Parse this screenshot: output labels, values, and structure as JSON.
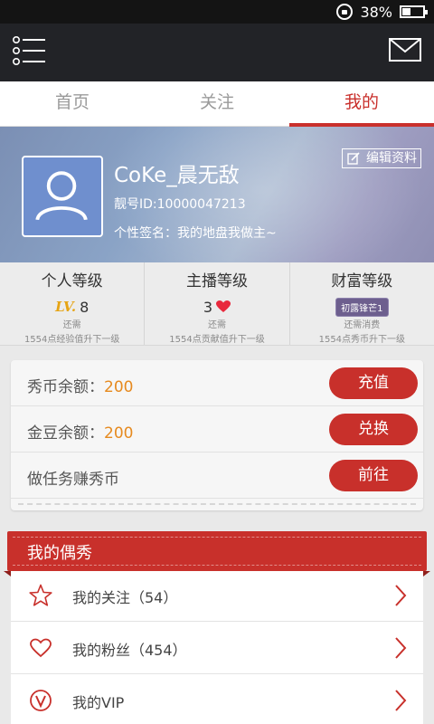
{
  "status_bar": {
    "battery_text": "38%"
  },
  "tabs": [
    {
      "label": "首页",
      "active": false
    },
    {
      "label": "关注",
      "active": false
    },
    {
      "label": "我的",
      "active": true
    }
  ],
  "profile": {
    "username": "CoKe_晨无敌",
    "user_id": "靓号ID:10000047213",
    "signature": "个性签名：我的地盘我做主~",
    "edit_label": "编辑资料"
  },
  "levels": [
    {
      "title": "个人等级",
      "prefix": "LV.",
      "value": "8",
      "need_1": "还需",
      "need_2": "1554点经验值升下一级"
    },
    {
      "title": "主播等级",
      "value": "3",
      "need_1": "还需",
      "need_2": "1554点贡献值升下一级"
    },
    {
      "title": "财富等级",
      "badge": "初露锋芒1",
      "need_1": "还需消费",
      "need_2": "1554点秀币升下一级"
    }
  ],
  "balance": {
    "rows": [
      {
        "label": "秀币余额：",
        "value": "200",
        "button": "充值"
      },
      {
        "label": "金豆余额：",
        "value": "200",
        "button": "兑换"
      },
      {
        "label": "做任务赚秀币",
        "value": "",
        "button": "前往"
      }
    ]
  },
  "section": {
    "title": "我的偶秀",
    "items": [
      {
        "label": "我的关注（54）",
        "icon": "star-icon"
      },
      {
        "label": "我的粉丝（454）",
        "icon": "heart-outline-icon"
      },
      {
        "label": "我的VIP",
        "icon": "vip-icon"
      }
    ]
  },
  "colors": {
    "accent": "#c8302b",
    "value_orange": "#e68a1f",
    "topbar": "#222327"
  }
}
